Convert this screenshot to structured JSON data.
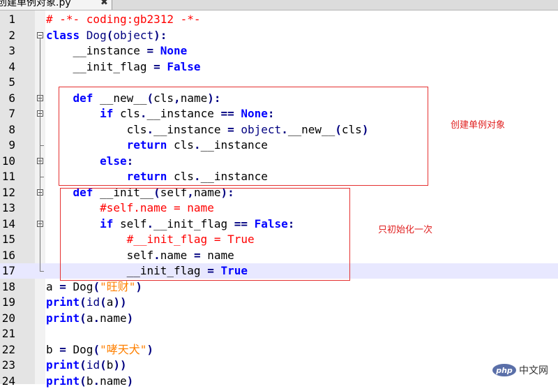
{
  "tab": {
    "filename": "创建单例对象.py",
    "close_glyph": "✖"
  },
  "annotations": {
    "new_label": "创建单例对象",
    "init_label": "只初始化一次"
  },
  "watermark": {
    "logo": "php",
    "text": "中文网"
  },
  "lines": [
    {
      "n": "1",
      "tokens": [
        {
          "t": "# -*- coding:gb2312 -*-",
          "c": "cm"
        }
      ]
    },
    {
      "n": "2",
      "tokens": [
        {
          "t": "class ",
          "c": "kw"
        },
        {
          "t": "Dog",
          "c": "bl"
        },
        {
          "t": "(",
          "c": "op"
        },
        {
          "t": "object",
          "c": "bl"
        },
        {
          "t": "):",
          "c": "op"
        }
      ]
    },
    {
      "n": "3",
      "tokens": [
        {
          "t": "    __instance ",
          "c": ""
        },
        {
          "t": "=",
          "c": "op"
        },
        {
          "t": " None",
          "c": "kw"
        }
      ]
    },
    {
      "n": "4",
      "tokens": [
        {
          "t": "    __init_flag ",
          "c": ""
        },
        {
          "t": "=",
          "c": "op"
        },
        {
          "t": " False",
          "c": "kw"
        }
      ]
    },
    {
      "n": "5",
      "tokens": []
    },
    {
      "n": "6",
      "tokens": [
        {
          "t": "    def ",
          "c": "kw"
        },
        {
          "t": "__new__",
          "c": ""
        },
        {
          "t": "(",
          "c": "op"
        },
        {
          "t": "cls",
          "c": ""
        },
        {
          "t": ",",
          "c": "op"
        },
        {
          "t": "name",
          "c": ""
        },
        {
          "t": "):",
          "c": "op"
        }
      ]
    },
    {
      "n": "7",
      "tokens": [
        {
          "t": "        if ",
          "c": "kw"
        },
        {
          "t": "cls",
          "c": ""
        },
        {
          "t": ".",
          "c": "op"
        },
        {
          "t": "__instance ",
          "c": ""
        },
        {
          "t": "==",
          "c": "op"
        },
        {
          "t": " None",
          "c": "kw"
        },
        {
          "t": ":",
          "c": "op"
        }
      ]
    },
    {
      "n": "8",
      "tokens": [
        {
          "t": "            cls",
          "c": ""
        },
        {
          "t": ".",
          "c": "op"
        },
        {
          "t": "__instance ",
          "c": ""
        },
        {
          "t": "=",
          "c": "op"
        },
        {
          "t": " object",
          "c": "bl"
        },
        {
          "t": ".",
          "c": "op"
        },
        {
          "t": "__new__",
          "c": ""
        },
        {
          "t": "(",
          "c": "op"
        },
        {
          "t": "cls",
          "c": ""
        },
        {
          "t": ")",
          "c": "op"
        }
      ]
    },
    {
      "n": "9",
      "tokens": [
        {
          "t": "            return ",
          "c": "kw"
        },
        {
          "t": "cls",
          "c": ""
        },
        {
          "t": ".",
          "c": "op"
        },
        {
          "t": "__instance",
          "c": ""
        }
      ]
    },
    {
      "n": "10",
      "tokens": [
        {
          "t": "        else",
          "c": "kw"
        },
        {
          "t": ":",
          "c": "op"
        }
      ]
    },
    {
      "n": "11",
      "tokens": [
        {
          "t": "            return ",
          "c": "kw"
        },
        {
          "t": "cls",
          "c": ""
        },
        {
          "t": ".",
          "c": "op"
        },
        {
          "t": "__instance",
          "c": ""
        }
      ]
    },
    {
      "n": "12",
      "tokens": [
        {
          "t": "    def ",
          "c": "kw"
        },
        {
          "t": "__init__",
          "c": ""
        },
        {
          "t": "(",
          "c": "op"
        },
        {
          "t": "self",
          "c": ""
        },
        {
          "t": ",",
          "c": "op"
        },
        {
          "t": "name",
          "c": ""
        },
        {
          "t": "):",
          "c": "op"
        }
      ]
    },
    {
      "n": "13",
      "tokens": [
        {
          "t": "        #self.name = name",
          "c": "cm"
        }
      ]
    },
    {
      "n": "14",
      "tokens": [
        {
          "t": "        if ",
          "c": "kw"
        },
        {
          "t": "self",
          "c": ""
        },
        {
          "t": ".",
          "c": "op"
        },
        {
          "t": "__init_flag ",
          "c": ""
        },
        {
          "t": "==",
          "c": "op"
        },
        {
          "t": " False",
          "c": "kw"
        },
        {
          "t": ":",
          "c": "op"
        }
      ]
    },
    {
      "n": "15",
      "tokens": [
        {
          "t": "            #__init_flag = True",
          "c": "cm"
        }
      ]
    },
    {
      "n": "16",
      "tokens": [
        {
          "t": "            self",
          "c": ""
        },
        {
          "t": ".",
          "c": "op"
        },
        {
          "t": "name ",
          "c": ""
        },
        {
          "t": "=",
          "c": "op"
        },
        {
          "t": " name",
          "c": ""
        }
      ]
    },
    {
      "n": "17",
      "tokens": [
        {
          "t": "            __init_flag ",
          "c": ""
        },
        {
          "t": "=",
          "c": "op"
        },
        {
          "t": " True",
          "c": "kw"
        }
      ]
    },
    {
      "n": "18",
      "tokens": [
        {
          "t": "a ",
          "c": ""
        },
        {
          "t": "=",
          "c": "op"
        },
        {
          "t": " Dog",
          "c": ""
        },
        {
          "t": "(",
          "c": "op"
        },
        {
          "t": "\"旺财\"",
          "c": "st"
        },
        {
          "t": ")",
          "c": "op"
        }
      ]
    },
    {
      "n": "19",
      "tokens": [
        {
          "t": "print",
          "c": "kw"
        },
        {
          "t": "(",
          "c": "op"
        },
        {
          "t": "id",
          "c": "bl"
        },
        {
          "t": "(",
          "c": "op"
        },
        {
          "t": "a",
          "c": ""
        },
        {
          "t": "))",
          "c": "op"
        }
      ]
    },
    {
      "n": "20",
      "tokens": [
        {
          "t": "print",
          "c": "kw"
        },
        {
          "t": "(",
          "c": "op"
        },
        {
          "t": "a",
          "c": ""
        },
        {
          "t": ".",
          "c": "op"
        },
        {
          "t": "name",
          "c": ""
        },
        {
          "t": ")",
          "c": "op"
        }
      ]
    },
    {
      "n": "21",
      "tokens": []
    },
    {
      "n": "22",
      "tokens": [
        {
          "t": "b ",
          "c": ""
        },
        {
          "t": "=",
          "c": "op"
        },
        {
          "t": " Dog",
          "c": ""
        },
        {
          "t": "(",
          "c": "op"
        },
        {
          "t": "\"哮天犬\"",
          "c": "st"
        },
        {
          "t": ")",
          "c": "op"
        }
      ]
    },
    {
      "n": "23",
      "tokens": [
        {
          "t": "print",
          "c": "kw"
        },
        {
          "t": "(",
          "c": "op"
        },
        {
          "t": "id",
          "c": "bl"
        },
        {
          "t": "(",
          "c": "op"
        },
        {
          "t": "b",
          "c": ""
        },
        {
          "t": "))",
          "c": "op"
        }
      ]
    },
    {
      "n": "24",
      "tokens": [
        {
          "t": "print",
          "c": "kw"
        },
        {
          "t": "(",
          "c": "op"
        },
        {
          "t": "b",
          "c": ""
        },
        {
          "t": ".",
          "c": "op"
        },
        {
          "t": "name",
          "c": ""
        },
        {
          "t": ")",
          "c": "op"
        }
      ]
    }
  ]
}
